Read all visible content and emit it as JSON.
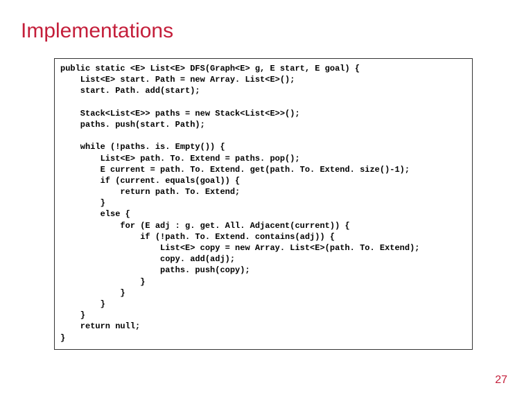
{
  "title": "Implementations",
  "page_number": "27",
  "code": {
    "l01": "public static <E> List<E> DFS(Graph<E> g, E start, E goal) {",
    "l02": "    List<E> start. Path = new Array. List<E>();",
    "l03": "    start. Path. add(start);",
    "l04": "",
    "l05": "    Stack<List<E>> paths = new Stack<List<E>>();",
    "l06": "    paths. push(start. Path);",
    "l07": "",
    "l08": "    while (!paths. is. Empty()) {",
    "l09": "        List<E> path. To. Extend = paths. pop();",
    "l10": "        E current = path. To. Extend. get(path. To. Extend. size()-1);",
    "l11": "        if (current. equals(goal)) {",
    "l12": "            return path. To. Extend;",
    "l13": "        }",
    "l14": "        else {",
    "l15": "            for (E adj : g. get. All. Adjacent(current)) {",
    "l16": "                if (!path. To. Extend. contains(adj)) {",
    "l17": "                    List<E> copy = new Array. List<E>(path. To. Extend);",
    "l18": "                    copy. add(adj);",
    "l19": "                    paths. push(copy);",
    "l20": "                }",
    "l21": "            }",
    "l22": "        }",
    "l23": "    }",
    "l24": "    return null;",
    "l25": "}"
  }
}
